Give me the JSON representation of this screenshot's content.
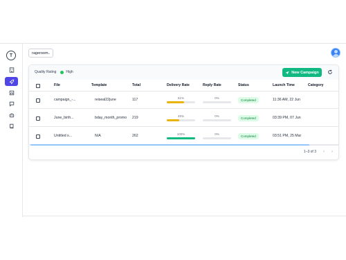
{
  "sidebar": {
    "logo_letter": "T",
    "items": [
      {
        "name": "dashboard",
        "icon": "building-icon",
        "active": false
      },
      {
        "name": "campaigns",
        "icon": "rocket-icon",
        "active": true
      },
      {
        "name": "reports",
        "icon": "chart-icon",
        "active": false
      },
      {
        "name": "chat",
        "icon": "chat-icon",
        "active": false
      },
      {
        "name": "bot",
        "icon": "bot-icon",
        "active": false
      },
      {
        "name": "docs",
        "icon": "book-icon",
        "active": false
      }
    ]
  },
  "header": {
    "workspace": "rageroom"
  },
  "card": {
    "quality_label": "Quality Rating",
    "quality_value": "High",
    "new_campaign_label": "New Campaign"
  },
  "table": {
    "columns": [
      "File",
      "Template",
      "Total",
      "Delivery Rate",
      "Reply Rate",
      "Status",
      "Launch Time",
      "Category"
    ],
    "rows": [
      {
        "file": "campaign_-...",
        "template": "reiseal22june",
        "total": "117",
        "delivery": "61%",
        "delivery_fraction": 0.61,
        "delivery_color": "#eab308",
        "reply": "0%",
        "status": "Completed",
        "launch": "11:36 AM, 22 Jun",
        "category": ""
      },
      {
        "file": "June_birth...",
        "template": "bday_month_promo",
        "total": "219",
        "delivery": "45%",
        "delivery_fraction": 0.45,
        "delivery_color": "#eab308",
        "reply": "0%",
        "status": "Completed",
        "launch": "03:39 PM, 07 Jun",
        "category": ""
      },
      {
        "file": "Untitled s...",
        "template": "N/A",
        "total": "262",
        "delivery": "100%",
        "delivery_fraction": 1.0,
        "delivery_color": "#10b981",
        "reply": "0%",
        "status": "Completed",
        "launch": "03:51 PM, 25 Mar",
        "category": ""
      }
    ]
  },
  "pagination": {
    "range": "1–3 of 3",
    "prev": "‹",
    "next": "›"
  }
}
